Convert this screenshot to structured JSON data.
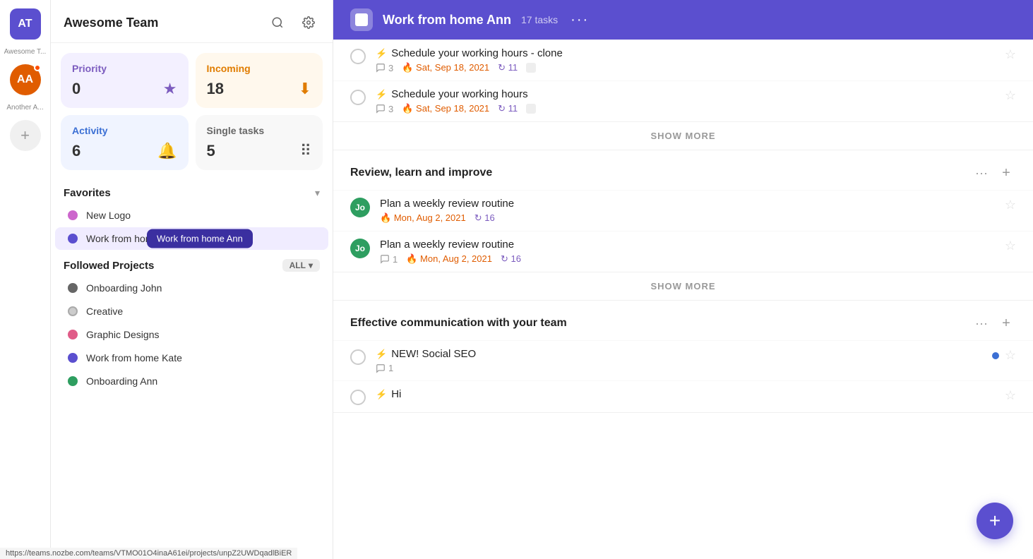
{
  "app": {
    "team_name": "Awesome Team",
    "avatar_at": "AT",
    "avatar_aa": "AA",
    "team_label": "Awesome T...",
    "other_label": "Another A..."
  },
  "stats": {
    "priority": {
      "label": "Priority",
      "value": "0"
    },
    "incoming": {
      "label": "Incoming",
      "value": "18"
    },
    "activity": {
      "label": "Activity",
      "value": "6"
    },
    "single": {
      "label": "Single tasks",
      "value": "5"
    }
  },
  "favorites": {
    "title": "Favorites",
    "items": [
      {
        "label": "New Logo",
        "color": "#cc66cc"
      },
      {
        "label": "Work from home",
        "color": "#5b4fcf"
      }
    ]
  },
  "followed_projects": {
    "title": "Followed Projects",
    "all_label": "ALL",
    "items": [
      {
        "label": "Onboarding John",
        "color": "#666"
      },
      {
        "label": "Creative",
        "color": "#ccc"
      },
      {
        "label": "Graphic Designs",
        "color": "#e05c88"
      },
      {
        "label": "Work from home Kate",
        "color": "#5b4fcf"
      },
      {
        "label": "Onboarding Ann",
        "color": "#2e9e60"
      }
    ]
  },
  "tooltip": "Work from home Ann",
  "content": {
    "project_title": "Work from home Ann",
    "tasks_count": "17 tasks",
    "more_btn": "···",
    "groups": [
      {
        "id": "group1",
        "title": "",
        "tasks": [
          {
            "name": "Schedule your working hours - clone",
            "priority": true,
            "comments": "3",
            "date": "Sat, Sep 18, 2021",
            "recur": "11",
            "has_tag": true,
            "starred": false
          },
          {
            "name": "Schedule your working hours",
            "priority": true,
            "comments": "3",
            "date": "Sat, Sep 18, 2021",
            "recur": "11",
            "has_tag": true,
            "starred": false
          }
        ],
        "show_more": "SHOW MORE"
      },
      {
        "id": "group2",
        "title": "Review, learn and improve",
        "tasks": [
          {
            "name": "Plan a weekly review routine",
            "avatar": "Jo",
            "date": "Mon, Aug 2, 2021",
            "recur": "16",
            "comments": "",
            "starred": false
          },
          {
            "name": "Plan a weekly review routine",
            "avatar": "Jo",
            "comments": "1",
            "date": "Mon, Aug 2, 2021",
            "recur": "16",
            "starred": false
          }
        ],
        "show_more": "SHOW MORE"
      },
      {
        "id": "group3",
        "title": "Effective communication with your team",
        "tasks": [
          {
            "name": "NEW! Social SEO",
            "priority": true,
            "comments": "1",
            "has_blue_dot": true,
            "starred": false
          },
          {
            "name": "Hi",
            "priority": true,
            "comments": "",
            "starred": false
          }
        ],
        "show_more": ""
      }
    ]
  },
  "fab_label": "+",
  "url_bar": "https://teams.nozbe.com/teams/VTMO01O4inaA61ei/projects/unpZ2UWDqadlBiER"
}
